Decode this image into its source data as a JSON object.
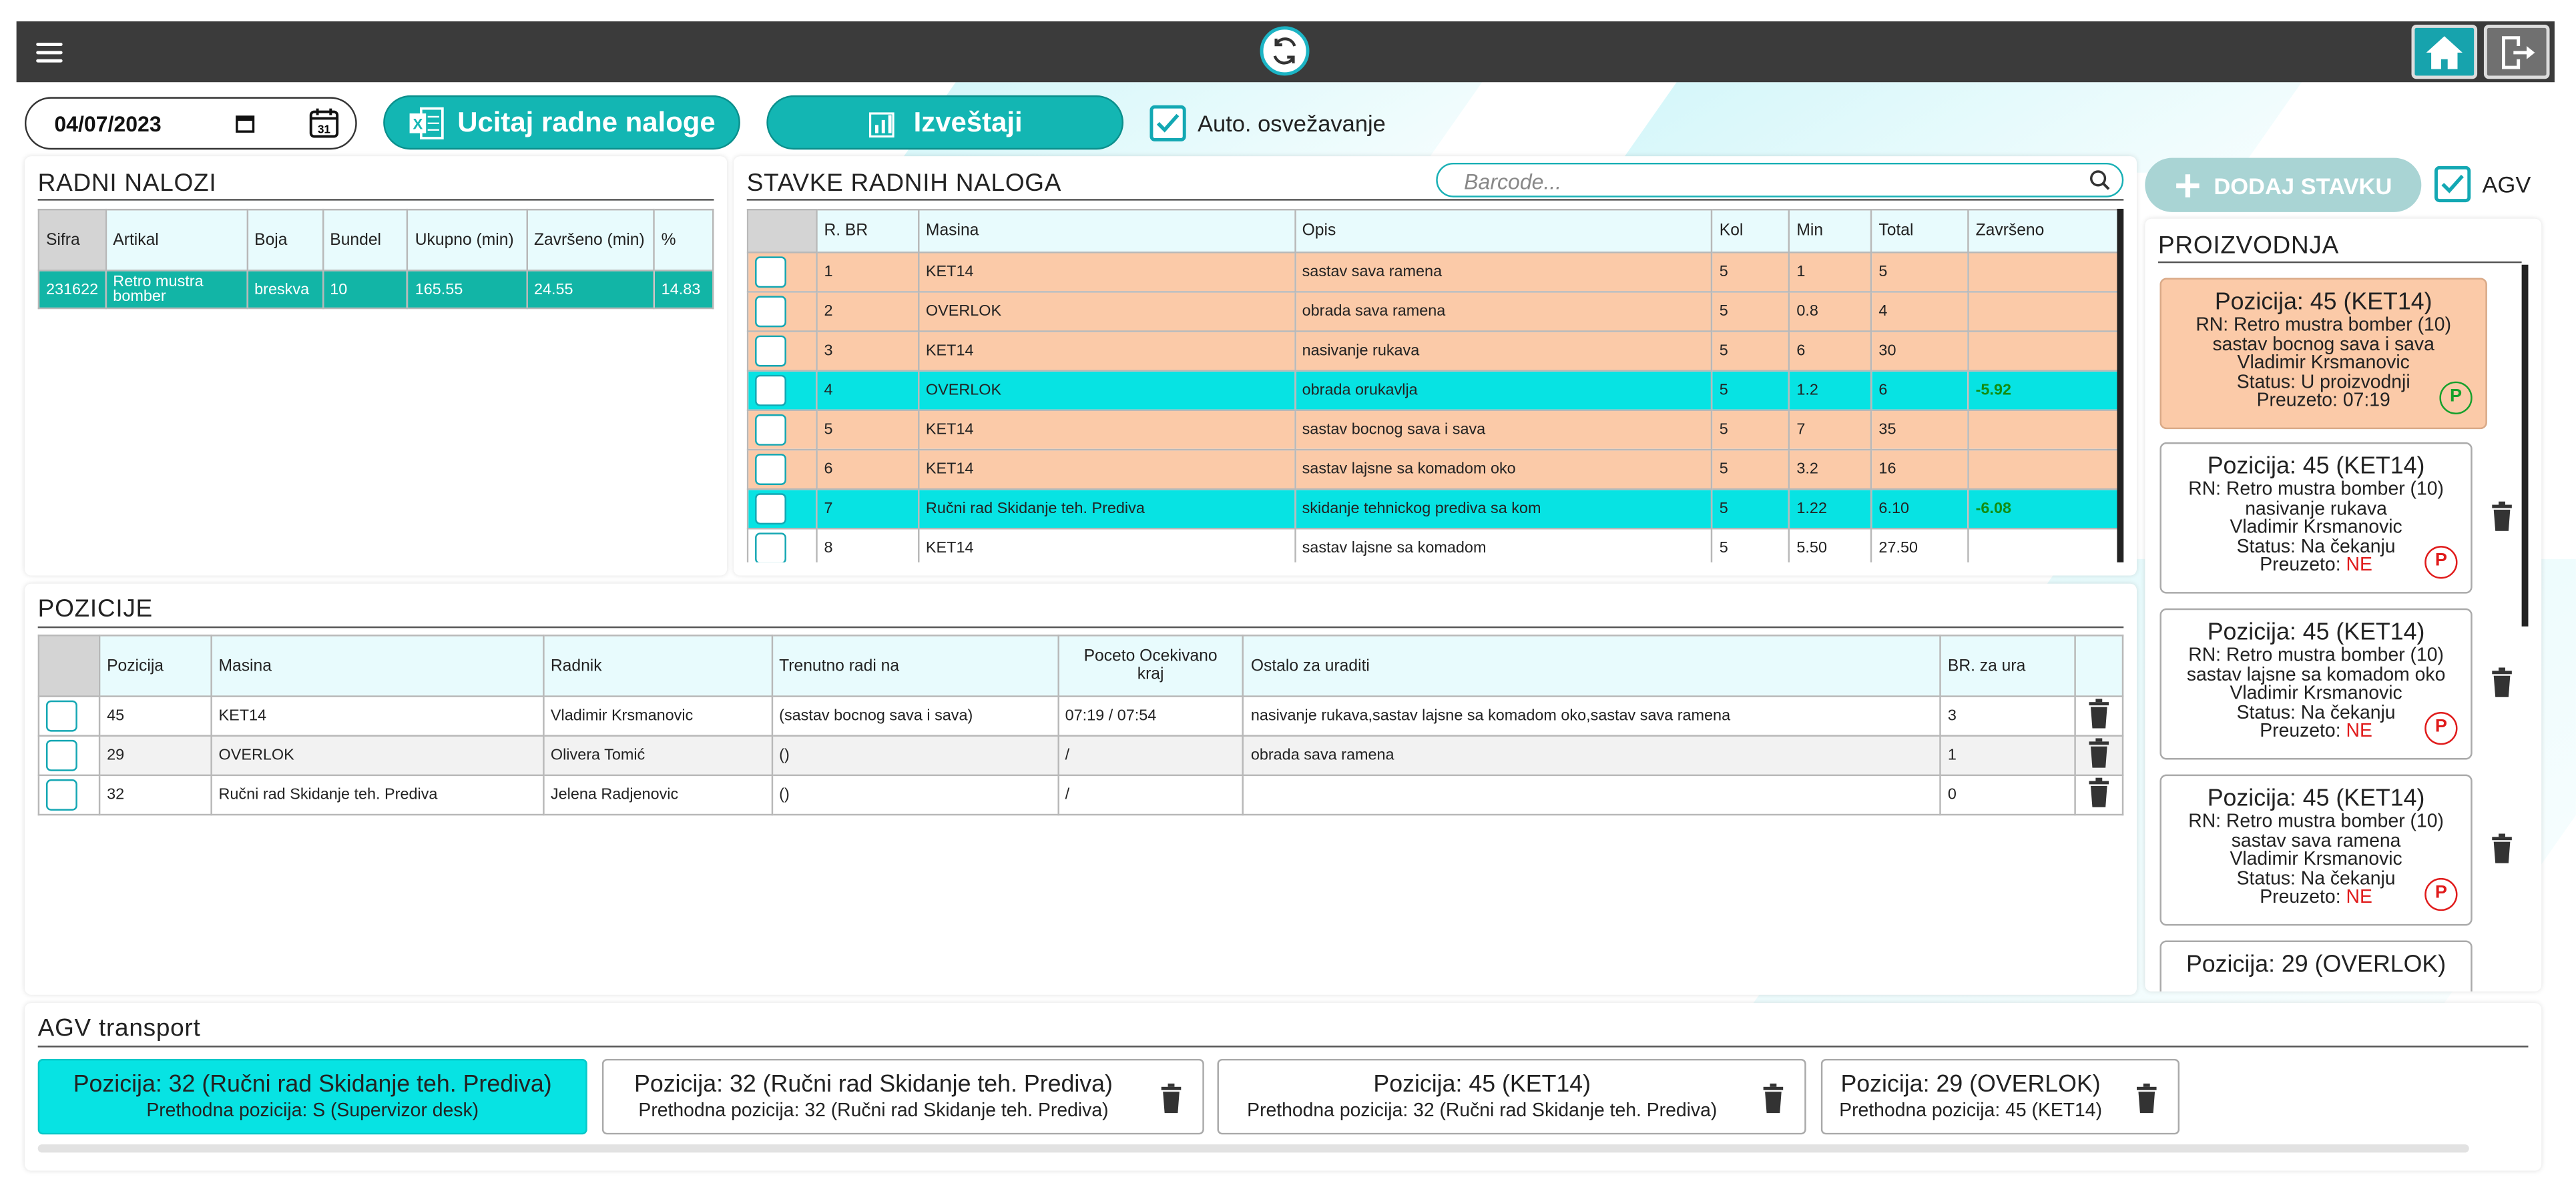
{
  "header": {
    "menu_icon": "hamburger-icon",
    "refresh_icon": "refresh-icon",
    "home_icon": "home-icon",
    "logout_icon": "logout-icon"
  },
  "controls": {
    "date": "04/07/2023",
    "load_button": "Ucitaj radne naloge",
    "reports_button": "Izveštaji",
    "auto_refresh_label": "Auto. osvežavanje",
    "auto_refresh_checked": true
  },
  "radni_nalozi": {
    "title": "RADNI NALOZI",
    "headers": [
      "Sifra",
      "Artikal",
      "Boja",
      "Bundel",
      "Ukupno (min)",
      "Završeno (min)",
      "%"
    ],
    "rows": [
      [
        "231622",
        "Retro mustra bomber",
        "breskva",
        "10",
        "165.55",
        "24.55",
        "14.83"
      ]
    ]
  },
  "stavke": {
    "title": "STAVKE RADNIH NALOGA",
    "search_placeholder": "Barcode...",
    "headers": [
      "",
      "R. BR",
      "Masina",
      "Opis",
      "Kol",
      "Min",
      "Total",
      "Završeno"
    ],
    "rows": [
      {
        "rbr": "1",
        "masina": "KET14",
        "opis": "sastav sava ramena",
        "kol": "5",
        "min": "1",
        "total": "5",
        "zavrseno": "",
        "color": "peach"
      },
      {
        "rbr": "2",
        "masina": "OVERLOK",
        "opis": "obrada sava ramena",
        "kol": "5",
        "min": "0.8",
        "total": "4",
        "zavrseno": "",
        "color": "peach"
      },
      {
        "rbr": "3",
        "masina": "KET14",
        "opis": "nasivanje rukava",
        "kol": "5",
        "min": "6",
        "total": "30",
        "zavrseno": "",
        "color": "peach"
      },
      {
        "rbr": "4",
        "masina": "OVERLOK",
        "opis": "obrada orukavlja",
        "kol": "5",
        "min": "1.2",
        "total": "6",
        "zavrseno": "-5.92",
        "color": "cyan"
      },
      {
        "rbr": "5",
        "masina": "KET14",
        "opis": "sastav bocnog sava i sava",
        "kol": "5",
        "min": "7",
        "total": "35",
        "zavrseno": "",
        "color": "peach"
      },
      {
        "rbr": "6",
        "masina": "KET14",
        "opis": "sastav lajsne sa komadom oko",
        "kol": "5",
        "min": "3.2",
        "total": "16",
        "zavrseno": "",
        "color": "peach"
      },
      {
        "rbr": "7",
        "masina": "Ručni rad Skidanje teh. Prediva",
        "opis": "skidanje tehnickog prediva sa kom",
        "kol": "5",
        "min": "1.22",
        "total": "6.10",
        "zavrseno": "-6.08",
        "color": "cyan"
      },
      {
        "rbr": "8",
        "masina": "KET14",
        "opis": "sastav lajsne sa komadom",
        "kol": "5",
        "min": "5.50",
        "total": "27.50",
        "zavrseno": "",
        "color": "white"
      }
    ]
  },
  "sidebar": {
    "add_button": "DODAJ STAVKU",
    "agv_label": "AGV",
    "agv_checked": true,
    "proizvodnja_title": "PROIZVODNJA",
    "cards": [
      {
        "title": "Pozicija: 45 (KET14)",
        "rn": "RN: Retro mustra bomber (10)",
        "task": "sastav bocnog sava i sava",
        "worker": "Vladimir Krsmanovic",
        "status": "Status: U proizvodnji",
        "preuzeto_label": "Preuzeto:",
        "preuzeto": "07:19",
        "badge": "P",
        "active": true
      },
      {
        "title": "Pozicija: 45 (KET14)",
        "rn": "RN: Retro mustra bomber (10)",
        "task": "nasivanje rukava",
        "worker": "Vladimir Krsmanovic",
        "status": "Status: Na čekanju",
        "preuzeto_label": "Preuzeto:",
        "preuzeto": "NE",
        "badge": "P",
        "active": false
      },
      {
        "title": "Pozicija: 45 (KET14)",
        "rn": "RN: Retro mustra bomber (10)",
        "task": "sastav lajsne sa komadom oko",
        "worker": "Vladimir Krsmanovic",
        "status": "Status: Na čekanju",
        "preuzeto_label": "Preuzeto:",
        "preuzeto": "NE",
        "badge": "P",
        "active": false
      },
      {
        "title": "Pozicija: 45 (KET14)",
        "rn": "RN: Retro mustra bomber (10)",
        "task": "sastav sava ramena",
        "worker": "Vladimir Krsmanovic",
        "status": "Status: Na čekanju",
        "preuzeto_label": "Preuzeto:",
        "preuzeto": "NE",
        "badge": "P",
        "active": false
      },
      {
        "title": "Pozicija: 29 (OVERLOK)"
      }
    ]
  },
  "pozicije": {
    "title": "POZICIJE",
    "headers": [
      "",
      "Pozicija",
      "Masina",
      "Radnik",
      "Trenutno radi na",
      "Poceto Ocekivano kraj",
      "Ostalo za uraditi",
      "BR. za ura",
      ""
    ],
    "rows": [
      {
        "pozicija": "45",
        "masina": "KET14",
        "radnik": "Vladimir Krsmanovic",
        "trenutno": "(sastav bocnog sava i sava)",
        "poceto": "07:19 / 07:54",
        "ostalo": "nasivanje rukava,sastav lajsne sa komadom oko,sastav sava ramena",
        "br": "3"
      },
      {
        "pozicija": "29",
        "masina": "OVERLOK",
        "radnik": "Olivera Tomić",
        "trenutno": "()",
        "poceto": "/",
        "ostalo": "obrada sava ramena",
        "br": "1"
      },
      {
        "pozicija": "32",
        "masina": "Ručni rad Skidanje teh. Prediva",
        "radnik": "Jelena Radjenovic",
        "trenutno": "()",
        "poceto": "/",
        "ostalo": "",
        "br": "0"
      }
    ]
  },
  "agv": {
    "title": "AGV transport",
    "cards": [
      {
        "title": "Pozicija: 32 (Ručni rad Skidanje teh. Prediva)",
        "sub": "Prethodna pozicija: S (Supervizor desk)",
        "active": true
      },
      {
        "title": "Pozicija: 32 (Ručni rad Skidanje teh. Prediva)",
        "sub": "Prethodna pozicija: 32 (Ručni rad Skidanje teh. Prediva)",
        "active": false
      },
      {
        "title": "Pozicija: 45 (KET14)",
        "sub": "Prethodna pozicija: 32 (Ručni rad Skidanje teh. Prediva)",
        "active": false
      },
      {
        "title": "Pozicija: 29 (OVERLOK)",
        "sub": "Prethodna pozicija: 45 (KET14)",
        "active": false
      }
    ]
  },
  "colors": {
    "teal": "#13b6b3",
    "peach": "#fbcaa8",
    "cyan": "#07e3e3",
    "header_bg": "#3b3b3b"
  }
}
